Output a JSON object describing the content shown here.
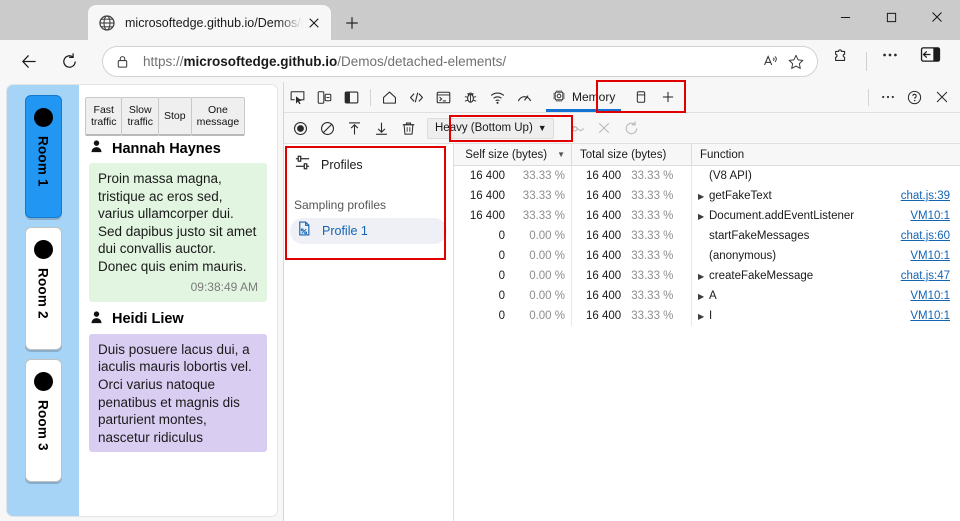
{
  "browser": {
    "tab": {
      "title": "microsoftedge.github.io/Demos/d",
      "favicon_icon": "globe-icon",
      "close_icon": "close-icon"
    },
    "new_tab_icon": "plus-icon",
    "window_controls": {
      "minimize_icon": "minimize-icon",
      "maximize_icon": "maximize-icon",
      "close_icon": "close-icon"
    },
    "nav": {
      "back_icon": "back-arrow-icon",
      "refresh_icon": "reload-icon",
      "lock_icon": "lock-icon",
      "url_scheme": "https://",
      "url_host": "microsoftedge.github.io",
      "url_path": "/Demos/detached-elements/",
      "read_aloud_icon": "read-aloud-icon",
      "favorite_icon": "star-icon",
      "extensions_icon": "extensions-puzzle-icon",
      "settings_icon": "ellipsis-icon",
      "sidebar_icon": "split-screen-icon"
    }
  },
  "page": {
    "rooms": [
      {
        "label": "Room 1",
        "active": true
      },
      {
        "label": "Room 2",
        "active": false
      },
      {
        "label": "Room 3",
        "active": false
      }
    ],
    "controls": [
      "Fast\ntraffic",
      "Slow\ntraffic",
      "Stop",
      "One\nmessage"
    ],
    "control_labels": {
      "fast_l1": "Fast",
      "fast_l2": "traffic",
      "slow_l1": "Slow",
      "slow_l2": "traffic",
      "stop": "Stop",
      "one_l1": "One",
      "one_l2": "message"
    },
    "messages": [
      {
        "author": "Hannah Haynes",
        "text": "Proin massa magna, tristique ac eros sed, varius ullamcorper dui. Sed dapibus justo sit amet dui convallis auctor. Donec quis enim mauris.",
        "time": "09:38:49 AM",
        "color": "green"
      },
      {
        "author": "Heidi Liew",
        "text": "Duis posuere lacus dui, a iaculis mauris lobortis vel. Orci varius natoque penatibus et magnis dis parturient montes, nascetur ridiculus",
        "time": "",
        "color": "purple"
      }
    ]
  },
  "devtools": {
    "left_icons": [
      "inspect-element-icon",
      "device-emulation-icon",
      "dock-side-icon"
    ],
    "tool_icons": [
      "welcome-home-icon",
      "elements-icon",
      "console-icon",
      "sources-debugger-icon",
      "network-icon",
      "performance-icon"
    ],
    "active_tab": {
      "label": "Memory",
      "icon": "memory-chip-icon"
    },
    "application_icon": "application-storage-icon",
    "more_tools_icon": "plus-icon",
    "right_icons": {
      "more_icon": "ellipsis-icon",
      "help_icon": "question-circle-icon",
      "close_icon": "close-icon"
    },
    "toolbar2": {
      "record_icon": "record-circle-icon",
      "clear_icon": "no-entry-icon",
      "load_icon": "upload-arrow-icon",
      "save_icon": "download-arrow-icon",
      "delete_icon": "trash-icon",
      "view_select": "Heavy (Bottom Up)",
      "caret_icon": "chevron-down-icon",
      "focus_icon": "focus-selected-icon",
      "exclude_icon": "exclude-icon",
      "restore_icon": "restore-all-icon"
    },
    "profiles": {
      "header": "Profiles",
      "header_icon": "profiles-settings-icon",
      "group_label": "Sampling profiles",
      "items": [
        {
          "label": "Profile 1",
          "icon": "profile-document-icon",
          "selected": true
        }
      ]
    },
    "grid": {
      "columns": [
        {
          "label": "Self size (bytes)",
          "sorted": true,
          "sort_icon": "sort-desc-icon"
        },
        {
          "label": "Total size (bytes)",
          "sorted": false
        },
        {
          "label": "Function",
          "sorted": false
        }
      ],
      "rows": [
        {
          "self": "16 400",
          "self_pct": "33.33 %",
          "total": "16 400",
          "total_pct": "33.33 %",
          "expand": false,
          "fn": "(V8 API)",
          "src": ""
        },
        {
          "self": "16 400",
          "self_pct": "33.33 %",
          "total": "16 400",
          "total_pct": "33.33 %",
          "expand": true,
          "fn": "getFakeText",
          "src": "chat.js:39"
        },
        {
          "self": "16 400",
          "self_pct": "33.33 %",
          "total": "16 400",
          "total_pct": "33.33 %",
          "expand": true,
          "fn": "Document.addEventListener",
          "src": "VM10:1"
        },
        {
          "self": "0",
          "self_pct": "0.00 %",
          "total": "16 400",
          "total_pct": "33.33 %",
          "expand": false,
          "fn": "startFakeMessages",
          "src": "chat.js:60"
        },
        {
          "self": "0",
          "self_pct": "0.00 %",
          "total": "16 400",
          "total_pct": "33.33 %",
          "expand": false,
          "fn": "(anonymous)",
          "src": "VM10:1"
        },
        {
          "self": "0",
          "self_pct": "0.00 %",
          "total": "16 400",
          "total_pct": "33.33 %",
          "expand": true,
          "fn": "createFakeMessage",
          "src": "chat.js:47"
        },
        {
          "self": "0",
          "self_pct": "0.00 %",
          "total": "16 400",
          "total_pct": "33.33 %",
          "expand": true,
          "fn": "A",
          "src": "VM10:1"
        },
        {
          "self": "0",
          "self_pct": "0.00 %",
          "total": "16 400",
          "total_pct": "33.33 %",
          "expand": true,
          "fn": "I",
          "src": "VM10:1"
        }
      ]
    }
  },
  "annotations": {
    "highlight_color": "#e00000",
    "boxes": [
      "memory-tab-highlight",
      "view-select-highlight",
      "profiles-panel-highlight"
    ]
  }
}
